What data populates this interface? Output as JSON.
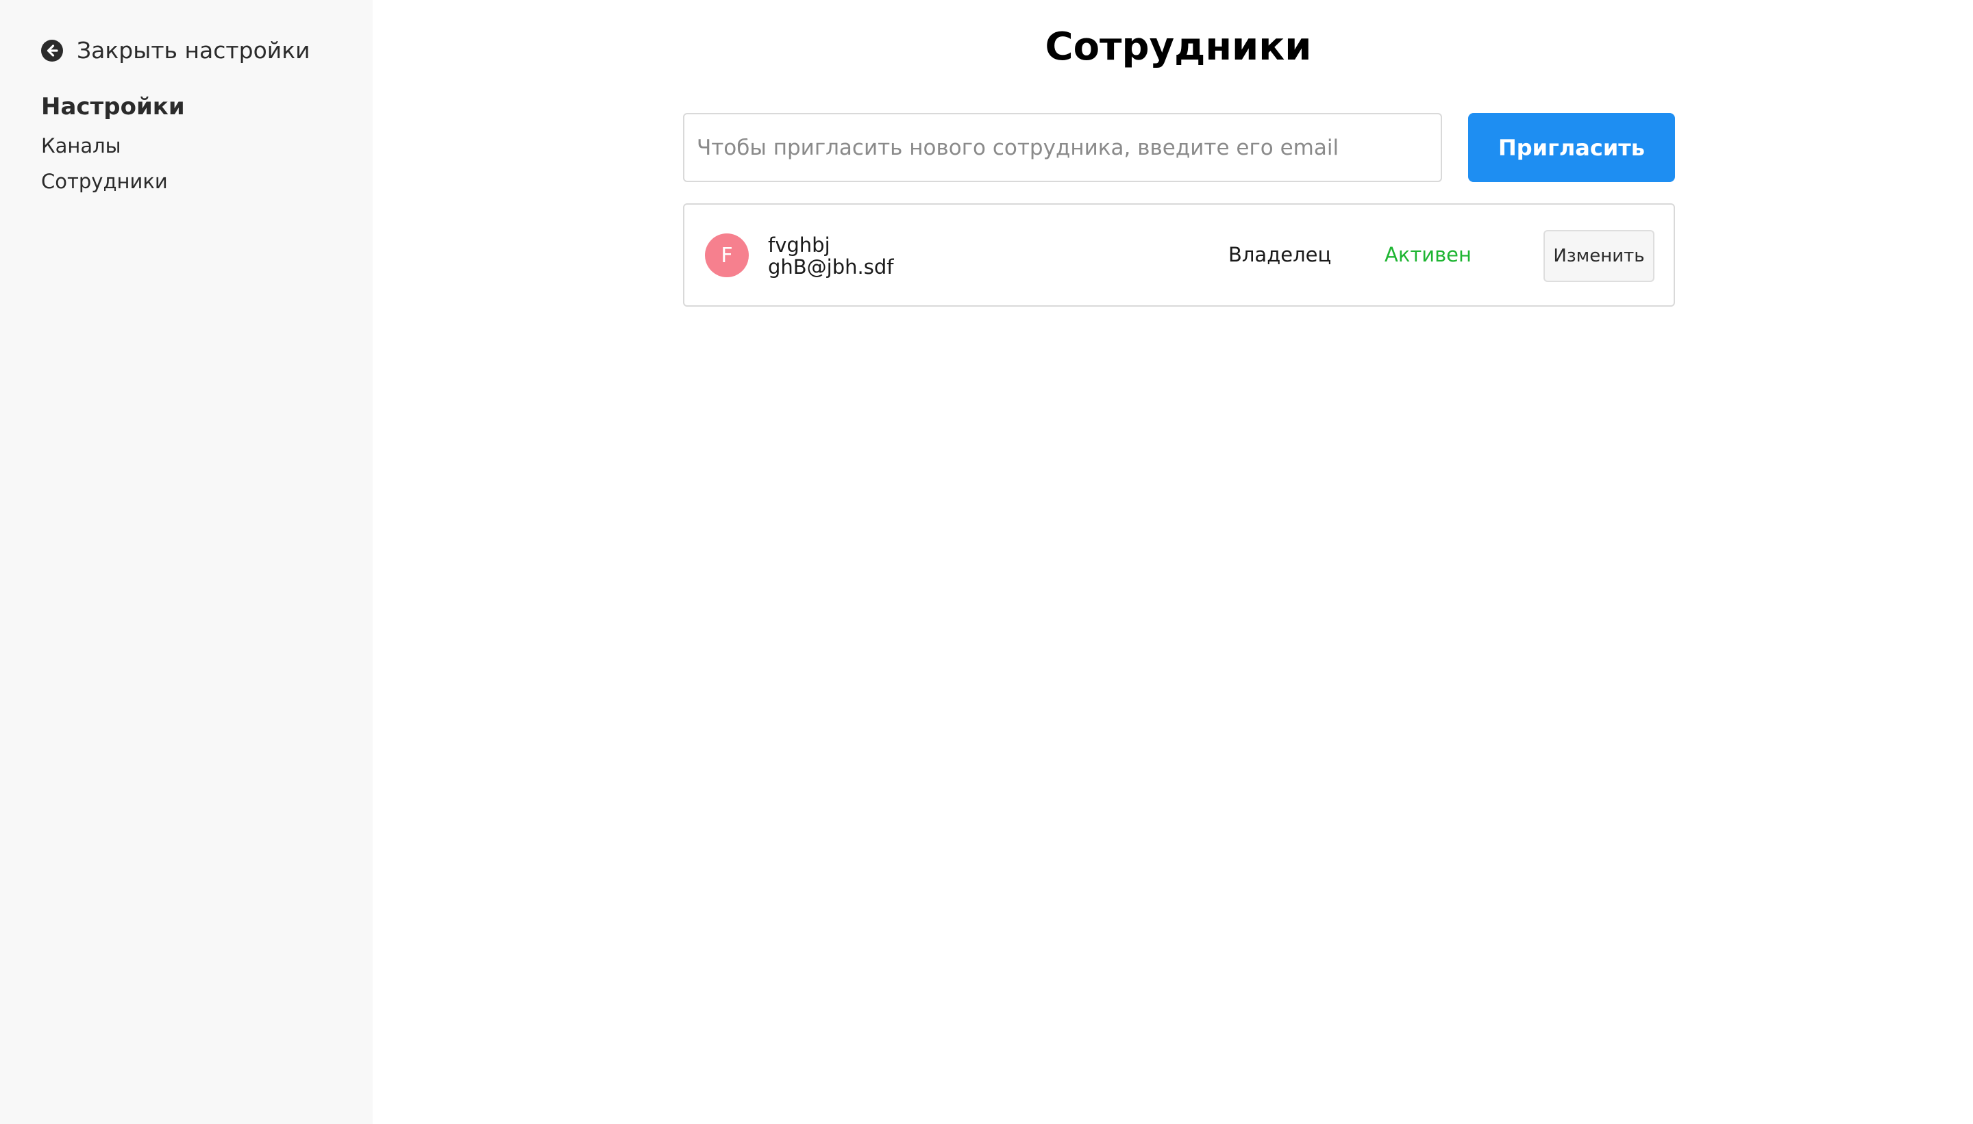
{
  "sidebar": {
    "close_label": "Закрыть настройки",
    "close_icon": "arrow-left-circle-icon",
    "heading": "Настройки",
    "items": [
      {
        "label": "Каналы"
      },
      {
        "label": "Сотрудники"
      }
    ]
  },
  "main": {
    "title": "Сотрудники",
    "invite": {
      "placeholder": "Чтобы пригласить нового сотрудника, введите его email",
      "value": "",
      "button_label": "Пригласить"
    },
    "employees": [
      {
        "avatar_letter": "F",
        "name": "fvghbj",
        "email": "ghB@jbh.sdf",
        "role": "Владелец",
        "status": "Активен",
        "edit_label": "Изменить"
      }
    ]
  },
  "colors": {
    "accent": "#1e8ef2",
    "status_active": "#1eb532",
    "avatar": "#f6808e",
    "sidebar_bg": "#f8f8f8"
  }
}
